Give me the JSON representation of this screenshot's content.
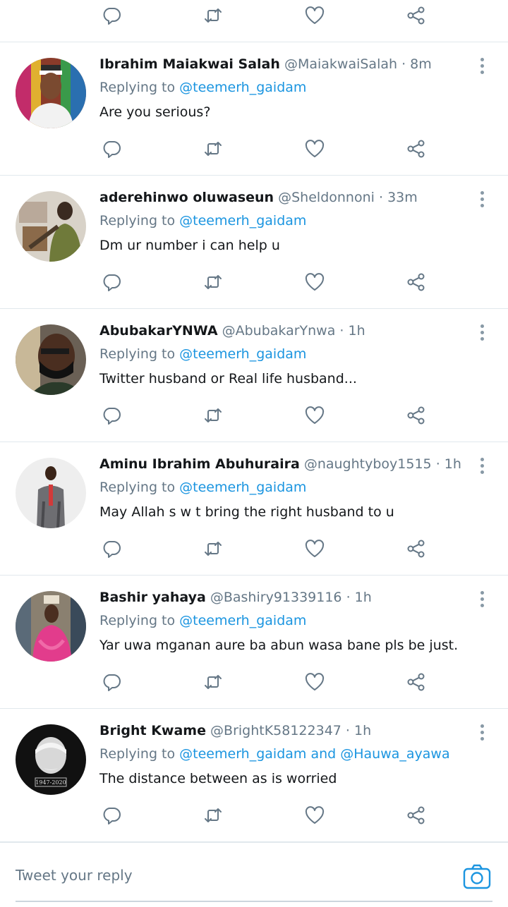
{
  "colors": {
    "link": "#1b95e0",
    "muted": "#657786",
    "text": "#14171a",
    "divider": "#e1e8ed"
  },
  "icons": {
    "reply": "reply-icon",
    "retweet": "retweet-icon",
    "like": "heart-icon",
    "share": "share-icon",
    "more": "more-vertical-icon",
    "camera": "camera-icon"
  },
  "tweets": [
    {
      "name": "Ibrahim Maiakwai Salah",
      "handle": "@MaiakwaiSalah",
      "sep": "·",
      "time": "8m",
      "replying_prefix": "Replying to",
      "mentions": "@teemerh_gaidam",
      "text": "Are you serious?"
    },
    {
      "name": "aderehinwo oluwaseun",
      "handle": "@Sheldonnoni",
      "sep": "·",
      "time": "33m",
      "replying_prefix": "Replying to",
      "mentions": "@teemerh_gaidam",
      "text": "Dm ur number i can help u"
    },
    {
      "name": "AbubakarYNWA",
      "handle": "@AbubakarYnwa",
      "sep": "·",
      "time": "1h",
      "replying_prefix": "Replying to",
      "mentions": "@teemerh_gaidam",
      "text": "Twitter husband or Real life husband..."
    },
    {
      "name": "Aminu Ibrahim Abuhuraira",
      "handle": "@naughtyboy1515",
      "sep": "·",
      "time": "1h",
      "replying_prefix": "Replying to",
      "mentions": "@teemerh_gaidam",
      "text": "May Allah s w t bring the right husband to u"
    },
    {
      "name": "Bashir yahaya",
      "handle": "@Bashiry91339116",
      "sep": "·",
      "time": "1h",
      "replying_prefix": "Replying to",
      "mentions": "@teemerh_gaidam",
      "text": "Yar uwa mganan aure ba abun wasa bane pls be just."
    },
    {
      "name": "Bright Kwame",
      "handle": "@BrightK58122347",
      "sep": "·",
      "time": "1h",
      "replying_prefix": "Replying to",
      "mentions": "@teemerh_gaidam and @Hauwa_ayawa",
      "text": "The distance between as is worried"
    }
  ],
  "avatar_caption": "1947-2020",
  "composer": {
    "placeholder": "Tweet your reply"
  }
}
